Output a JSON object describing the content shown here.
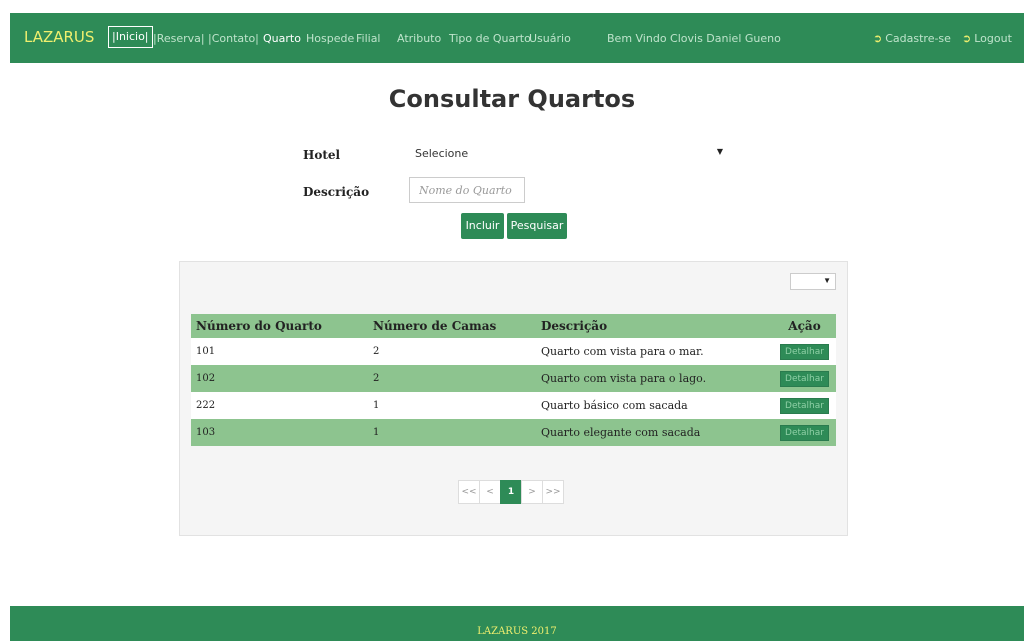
{
  "navbar": {
    "brand": "LAZARUS",
    "links": [
      "|Inicio|",
      "|Reserva|",
      "|Contato|",
      "Quarto",
      "Hospede",
      "Filial",
      "Atributo",
      "Tipo de Quarto",
      "Usuário"
    ],
    "welcome": "Bem Vindo Clovis Daniel Gueno",
    "signup_label": "Cadastre-se",
    "logout_label": "Logout",
    "signin_icon": "sign-in-icon"
  },
  "title": "Consultar Quartos",
  "form": {
    "hotel_label": "Hotel",
    "hotel_value": "Selecione",
    "desc_label": "Descrição",
    "desc_placeholder": "Nome do Quarto",
    "incluir_label": "Incluir",
    "pesquisar_label": "Pesquisar"
  },
  "table": {
    "headers": [
      "Número do Quarto",
      "Número de Camas",
      "Descrição",
      "Ação"
    ],
    "rows": [
      {
        "numero": "101",
        "camas": "2",
        "descricao": "Quarto com vista para o mar.",
        "acao": "Detalhar"
      },
      {
        "numero": "102",
        "camas": "2",
        "descricao": "Quarto com vista para o lago.",
        "acao": "Detalhar"
      },
      {
        "numero": "222",
        "camas": "1",
        "descricao": "Quarto básico com sacada",
        "acao": "Detalhar"
      },
      {
        "numero": "103",
        "camas": "1",
        "descricao": "Quarto elegante com sacada",
        "acao": "Detalhar"
      }
    ]
  },
  "pagination": {
    "first": "<<",
    "prev": "<",
    "current": "1",
    "next": ">",
    "last": ">>"
  },
  "footer": "LAZARUS 2017",
  "colors": {
    "primary": "#2e8b57",
    "row_alt": "#8dc48f",
    "brand_text": "#f0ef6e"
  }
}
